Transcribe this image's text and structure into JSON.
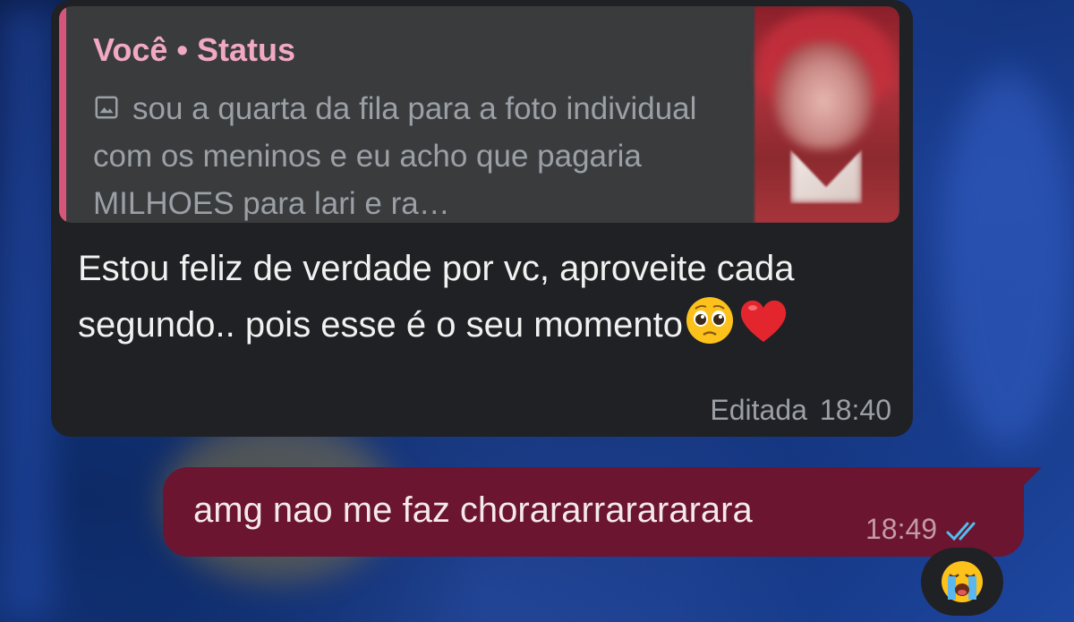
{
  "incoming_message": {
    "quote": {
      "author": "Você • Status",
      "text": "sou a quarta da fila para a foto individual com os meninos e eu acho que pagaria MILHOES para lari e ra…",
      "icon": "image-icon"
    },
    "text": "Estou feliz de verdade por vc, aproveite cada segundo.. pois esse é o seu momento",
    "emojis": [
      "pleading-face-emoji",
      "red-heart-emoji"
    ],
    "edited_label": "Editada",
    "time": "18:40"
  },
  "outgoing_message": {
    "text": "amg nao me faz chorararrarararara",
    "time": "18:49",
    "status_icon": "double-check-read-icon"
  },
  "reaction": {
    "emoji": "loudly-crying-face-emoji"
  },
  "colors": {
    "incoming_bubble": "#202124",
    "quote_bar": "#d6557a",
    "quote_author": "#f1a9c1",
    "outgoing_bubble": "#6b1530",
    "read_ticks": "#53bdeb"
  }
}
